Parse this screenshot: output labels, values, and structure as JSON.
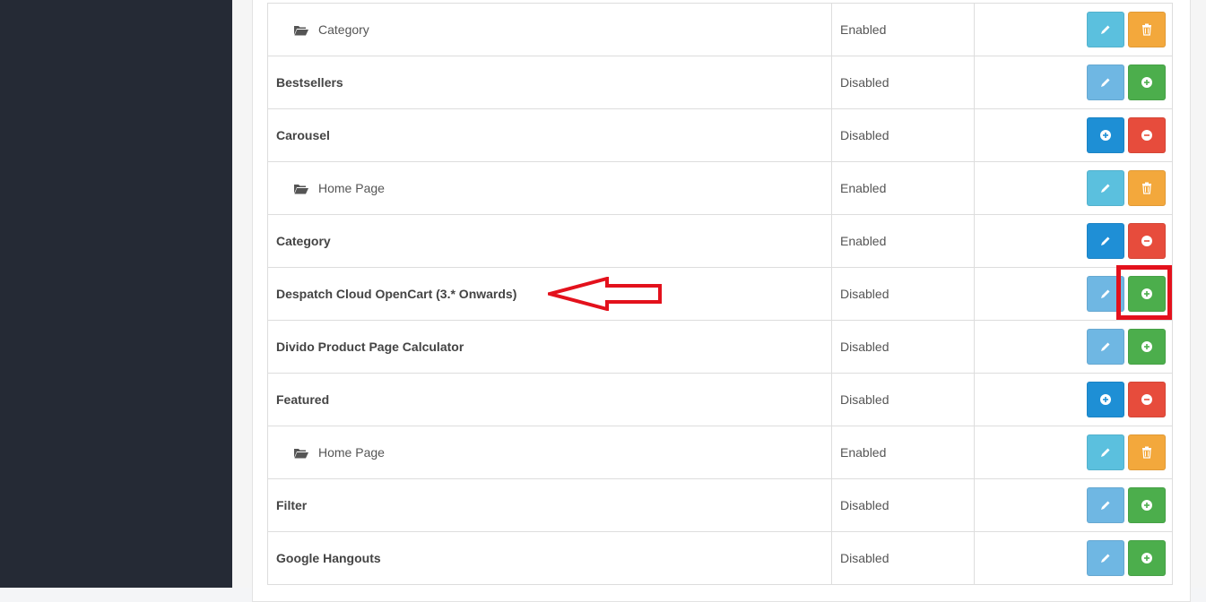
{
  "rows": [
    {
      "name": "Category",
      "status": "Enabled",
      "level": "child",
      "buttons": [
        "edit",
        "delete"
      ]
    },
    {
      "name": "Bestsellers",
      "status": "Disabled",
      "level": "parent",
      "buttons": [
        "edit-light",
        "install"
      ]
    },
    {
      "name": "Carousel",
      "status": "Disabled",
      "level": "parent",
      "buttons": [
        "add-blue",
        "uninstall"
      ]
    },
    {
      "name": "Home Page",
      "status": "Enabled",
      "level": "child",
      "buttons": [
        "edit",
        "delete"
      ]
    },
    {
      "name": "Category",
      "status": "Enabled",
      "level": "parent",
      "buttons": [
        "edit-dark",
        "uninstall"
      ]
    },
    {
      "name": "Despatch Cloud OpenCart (3.* Onwards)",
      "status": "Disabled",
      "level": "parent",
      "buttons": [
        "edit-light",
        "install"
      ]
    },
    {
      "name": "Divido Product Page Calculator",
      "status": "Disabled",
      "level": "parent",
      "buttons": [
        "edit-light",
        "install"
      ]
    },
    {
      "name": "Featured",
      "status": "Disabled",
      "level": "parent",
      "buttons": [
        "add-blue",
        "uninstall"
      ]
    },
    {
      "name": "Home Page",
      "status": "Enabled",
      "level": "child",
      "buttons": [
        "edit",
        "delete"
      ]
    },
    {
      "name": "Filter",
      "status": "Disabled",
      "level": "parent",
      "buttons": [
        "edit-light",
        "install"
      ]
    },
    {
      "name": "Google Hangouts",
      "status": "Disabled",
      "level": "parent",
      "buttons": [
        "edit-light",
        "install"
      ]
    }
  ],
  "colors": {
    "sidebar": "#252a35",
    "annotation": "#e3111c",
    "install": "#4cae4c",
    "uninstall": "#e74c3c",
    "edit": "#5bc0de",
    "delete": "#f3a83c"
  },
  "icons": {
    "edit": "pencil-icon",
    "delete": "trash-icon",
    "install": "plus-circle-icon",
    "uninstall": "minus-circle-icon",
    "folder": "folder-open-icon"
  }
}
